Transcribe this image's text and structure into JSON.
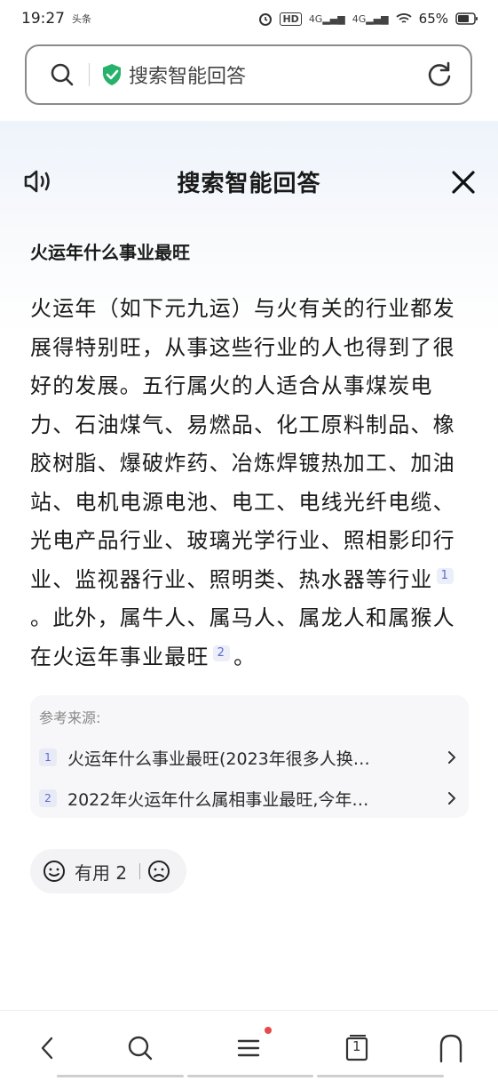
{
  "status": {
    "time": "19:27",
    "notification_badge": "头条",
    "battery": "65%",
    "signal_label_1": "4G",
    "signal_label_2": "4G",
    "hd_label": "HD"
  },
  "search": {
    "query": "搜索智能回答"
  },
  "header": {
    "title": "搜索智能回答"
  },
  "question": "火运年什么事业最旺",
  "answer": {
    "part1": "火运年（如下元九运）与火有关的行业都发展得特别旺，从事这些行业的人也得到了很好的发展。五行属火的人适合从事煤炭电力、石油煤气、易燃品、化工原料制品、橡胶树脂、爆破炸药、冶炼焊镀热加工、加油站、电机电源电池、电工、电线光纤电缆、光电产品行业、玻璃光学行业、照相影印行业、监视器行业、照明类、热水器等行业",
    "ref1": "1",
    "part2": "。此外，属牛人、属马人、属龙人和属猴人在火运年事业最旺",
    "ref2": "2",
    "part3": "。"
  },
  "sources": {
    "label": "参考来源:",
    "items": [
      {
        "num": "1",
        "text": "火运年什么事业最旺(2023年很多人换…"
      },
      {
        "num": "2",
        "text": "2022年火运年什么属相事业最旺,今年…"
      }
    ]
  },
  "feedback": {
    "useful_label": "有用",
    "useful_count": "2"
  },
  "nav": {
    "tabs_count": "1"
  },
  "colors": {
    "accent": "#5a6ccf",
    "shield_green": "#27b26b",
    "notification_dot": "#e84a4a"
  }
}
